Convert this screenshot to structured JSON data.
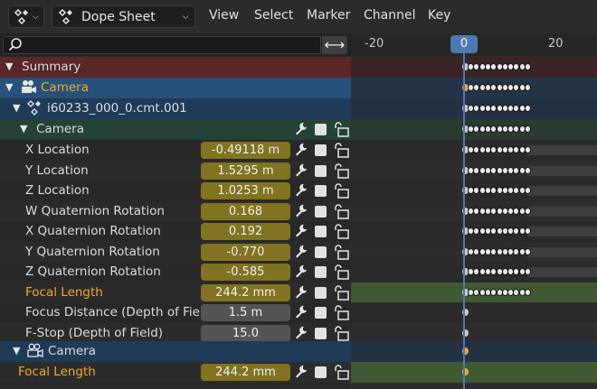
{
  "header": {
    "editor_type_icon": "dope-sheet-icon",
    "mode_icon": "dope-sheet-icon",
    "mode_label": "Dope Sheet",
    "menus": [
      "View",
      "Select",
      "Marker",
      "Channel",
      "Key"
    ]
  },
  "search": {
    "placeholder": "",
    "swap_glyph": "⟷"
  },
  "ruler": {
    "ticks": [
      "-20",
      "0",
      "20"
    ],
    "current_frame": "0"
  },
  "colors": {
    "accent": "#4d78b4",
    "anim_field": "#817320",
    "highlight_text": "#f0a92f",
    "summary_bg": "#5a2626",
    "object_bg": "#27507b",
    "camera_data_bg": "#244236"
  },
  "channels": {
    "summary": "Summary",
    "camera_object": "Camera",
    "action": "i60233_000_0.cmt.001",
    "group": "Camera",
    "fcurves": [
      {
        "label": "X Location",
        "value": "-0.49118 m",
        "animated": true,
        "highlight": false
      },
      {
        "label": "Y Location",
        "value": "1.5295 m",
        "animated": true,
        "highlight": false
      },
      {
        "label": "Z Location",
        "value": "1.0253 m",
        "animated": true,
        "highlight": false
      },
      {
        "label": "W Quaternion Rotation",
        "value": "0.168",
        "animated": true,
        "highlight": false
      },
      {
        "label": "X Quaternion Rotation",
        "value": "0.192",
        "animated": true,
        "highlight": false
      },
      {
        "label": "Y Quaternion Rotation",
        "value": "-0.770",
        "animated": true,
        "highlight": false
      },
      {
        "label": "Z Quaternion Rotation",
        "value": "-0.585",
        "animated": true,
        "highlight": false
      },
      {
        "label": "Focal Length",
        "value": "244.2 mm",
        "animated": true,
        "highlight": true
      },
      {
        "label": "Focus Distance (Depth of Field)",
        "value": "1.5 m",
        "animated": false,
        "highlight": false
      },
      {
        "label": "F-Stop (Depth of Field)",
        "value": "15.0",
        "animated": false,
        "highlight": false
      }
    ],
    "camera_data": "Camera",
    "camera_data_fcurve": {
      "label": "Focal Length",
      "value": "244.2 mm"
    }
  }
}
